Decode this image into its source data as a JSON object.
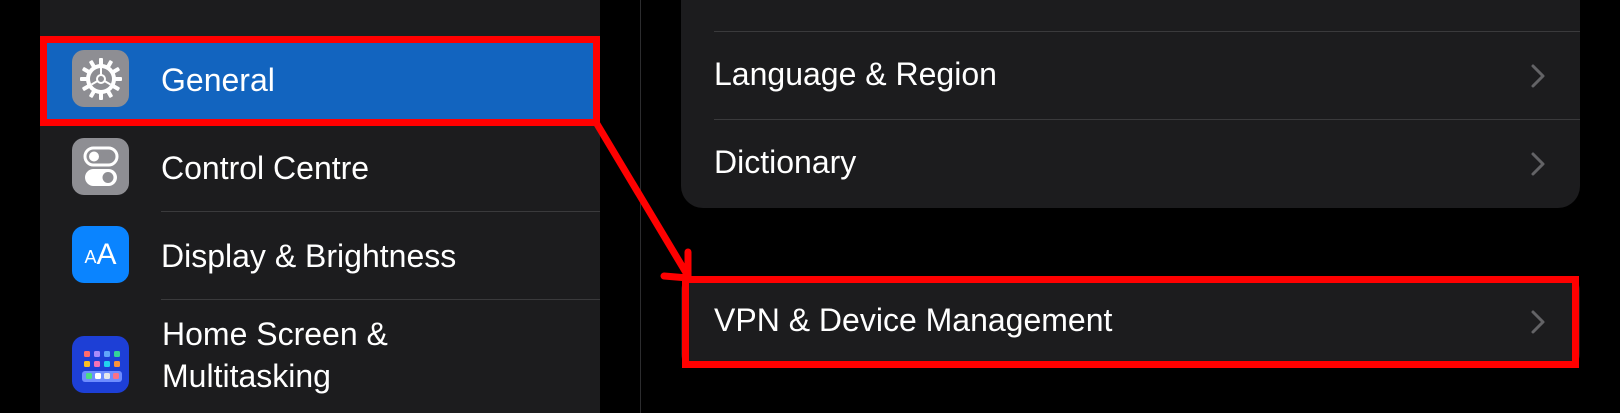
{
  "sidebar": {
    "items": [
      {
        "label": "General",
        "icon": "gear-icon",
        "icon_bg": "#8e8e93",
        "selected": true
      },
      {
        "label": "Control Centre",
        "icon": "toggles-icon",
        "icon_bg": "#8e8e93"
      },
      {
        "label": "Display & Brightness",
        "icon": "text-size-icon",
        "icon_bg": "#0a84ff",
        "icon_text": "AA"
      },
      {
        "label": "Home Screen &",
        "label2": "Multitasking",
        "icon": "home-grid-icon",
        "icon_bg": "#1d3fd6"
      }
    ],
    "selected_color": "#1264bf"
  },
  "settings_group": {
    "rows": [
      {
        "label": "Language & Region"
      },
      {
        "label": "Dictionary"
      }
    ]
  },
  "vpn_row": {
    "label": "VPN & Device Management"
  },
  "colors": {
    "annotation": "#ff0000",
    "background": "#000000",
    "cell": "#1c1c1e"
  }
}
